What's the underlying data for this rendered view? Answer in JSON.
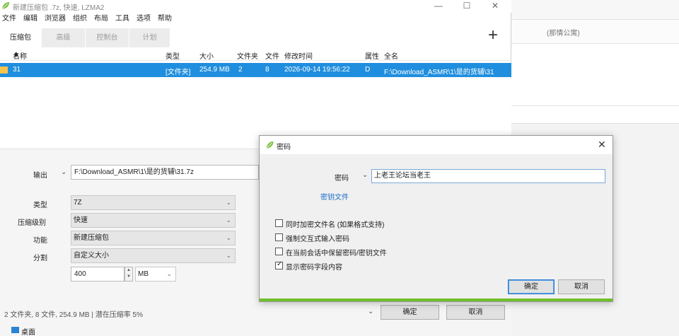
{
  "window": {
    "title": "新建压缩包 .7z, 快速, LZMA2",
    "minimize": "—",
    "maximize": "☐",
    "close": "✕"
  },
  "menu": [
    "文件",
    "编辑",
    "浏览器",
    "组织",
    "布局",
    "工具",
    "选项",
    "帮助"
  ],
  "tabs": [
    "压缩包",
    "高级",
    "控制台",
    "计划"
  ],
  "add_tab": "+",
  "columns": {
    "name": "名称",
    "type": "类型",
    "size": "大小",
    "folders": "文件夹",
    "files": "文件",
    "modified": "修改时间",
    "attr": "属性",
    "fullname": "全名"
  },
  "rows": [
    {
      "name": "31",
      "type": "[文件夹]",
      "size": "254.9 MB",
      "folders": "2",
      "files": "8",
      "modified": "2026-09-14 19:56:22",
      "attr": "D",
      "fullname": "F:\\Download_ASMR\\1\\是的货辅\\31"
    }
  ],
  "output": {
    "label": "输出",
    "value": "F:\\Download_ASMR\\1\\是的货辅\\31.7z"
  },
  "options": {
    "type_label": "类型",
    "type_value": "7Z",
    "level_label": "压缩级别",
    "level_value": "快速",
    "function_label": "功能",
    "function_value": "新建压缩包",
    "split_label": "分割",
    "split_value": "自定义大小",
    "split_size": "400",
    "split_unit": "MB"
  },
  "status": "2 文件夹, 8 文件, 254.9 MB | 潜在压缩率 5%",
  "buttons": {
    "ok": "确定",
    "cancel": "取消"
  },
  "taskbar_item": "桌面",
  "dialog": {
    "title": "密码",
    "close": "✕",
    "password_label": "密码",
    "password_value": "上老王论坛当老王",
    "keyfile_link": "密钥文件",
    "checkboxes": [
      {
        "label": "同时加密文件名 (如果格式支持)",
        "checked": false
      },
      {
        "label": "强制交互式输入密码",
        "checked": false
      },
      {
        "label": "在当前会话中保留密码/密钥文件",
        "checked": false
      },
      {
        "label": "显示密码字段内容",
        "checked": true
      }
    ],
    "ok": "确定",
    "cancel": "取消"
  },
  "background": {
    "hint_text": "(那情公寓)"
  },
  "colors": {
    "selection": "#1f8ede",
    "accent_green": "#6fbf2a",
    "link": "#1a6fc8"
  }
}
